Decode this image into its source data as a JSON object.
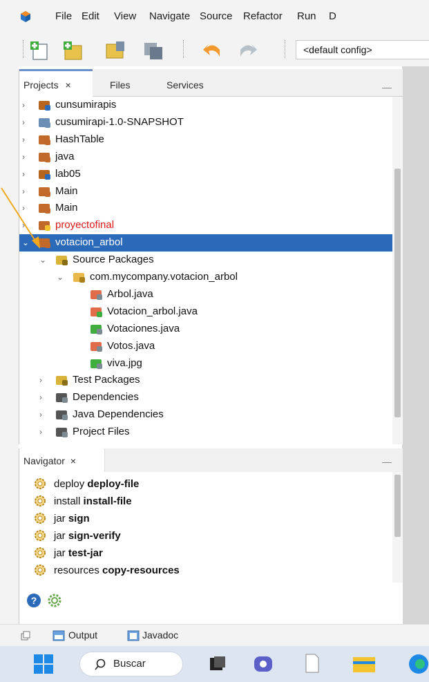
{
  "menubar": {
    "items": [
      "File",
      "Edit",
      "View",
      "Navigate",
      "Source",
      "Refactor",
      "Run",
      "D"
    ]
  },
  "toolbar": {
    "config_value": "<default config>"
  },
  "projects_panel": {
    "tabs": [
      {
        "label": "Projects",
        "close": "×",
        "active": true
      },
      {
        "label": "Files"
      },
      {
        "label": "Services"
      }
    ],
    "tree": [
      {
        "label": "cunsumirapis",
        "icon": "maven-project-icon",
        "chev": "›",
        "indent": 0
      },
      {
        "label": "cusumirapi-1.0-SNAPSHOT",
        "icon": "globe-project-icon",
        "chev": "›",
        "indent": 0
      },
      {
        "label": "HashTable",
        "icon": "java-project-icon",
        "chev": "›",
        "indent": 0
      },
      {
        "label": "java",
        "icon": "java-project-icon",
        "chev": "›",
        "indent": 0
      },
      {
        "label": "lab05",
        "icon": "maven-project-icon",
        "chev": "›",
        "indent": 0
      },
      {
        "label": "Main",
        "icon": "java-project-icon",
        "chev": "›",
        "indent": 0
      },
      {
        "label": "Main",
        "icon": "java-project-icon",
        "chev": "›",
        "indent": 0
      },
      {
        "label": "proyectofinal",
        "icon": "warning-project-icon",
        "chev": "›",
        "indent": 0,
        "error": true
      },
      {
        "label": "votacion_arbol",
        "icon": "java-project-icon",
        "chev": "⌄",
        "indent": 0,
        "selected": true
      },
      {
        "label": "Source Packages",
        "icon": "source-folder-icon",
        "chev": "⌄",
        "indent": 1
      },
      {
        "label": "com.mycompany.votacion_arbol",
        "icon": "package-icon",
        "chev": "⌄",
        "indent": 2
      },
      {
        "label": "Arbol.java",
        "icon": "java-file-icon",
        "chev": "",
        "indent": 3
      },
      {
        "label": "Votacion_arbol.java",
        "icon": "java-main-file-icon",
        "chev": "",
        "indent": 3
      },
      {
        "label": "Votaciones.java",
        "icon": "java-form-file-icon",
        "chev": "",
        "indent": 3
      },
      {
        "label": "Votos.java",
        "icon": "java-file-icon",
        "chev": "",
        "indent": 3
      },
      {
        "label": "viva.jpg",
        "icon": "image-file-icon",
        "chev": "",
        "indent": 3
      },
      {
        "label": "Test Packages",
        "icon": "test-folder-icon",
        "chev": "›",
        "indent": 1
      },
      {
        "label": "Dependencies",
        "icon": "library-folder-icon",
        "chev": "›",
        "indent": 1
      },
      {
        "label": "Java Dependencies",
        "icon": "library-folder-icon",
        "chev": "›",
        "indent": 1
      },
      {
        "label": "Project Files",
        "icon": "config-folder-icon",
        "chev": "›",
        "indent": 1
      }
    ]
  },
  "navigator": {
    "tab_label": "Navigator",
    "close": "×",
    "items": [
      {
        "prefix": "deploy",
        "goal": "deploy-file"
      },
      {
        "prefix": "install",
        "goal": "install-file"
      },
      {
        "prefix": "jar",
        "goal": "sign"
      },
      {
        "prefix": "jar",
        "goal": "sign-verify"
      },
      {
        "prefix": "jar",
        "goal": "test-jar"
      },
      {
        "prefix": "resources",
        "goal": "copy-resources"
      }
    ]
  },
  "bottom_bar": {
    "output_label": "Output",
    "javadoc_label": "Javadoc"
  },
  "taskbar": {
    "search_label": "Buscar"
  },
  "colors": {
    "selection": "#2a6ab8",
    "error_text": "#e01818",
    "tab_accent": "#6f8fca"
  }
}
